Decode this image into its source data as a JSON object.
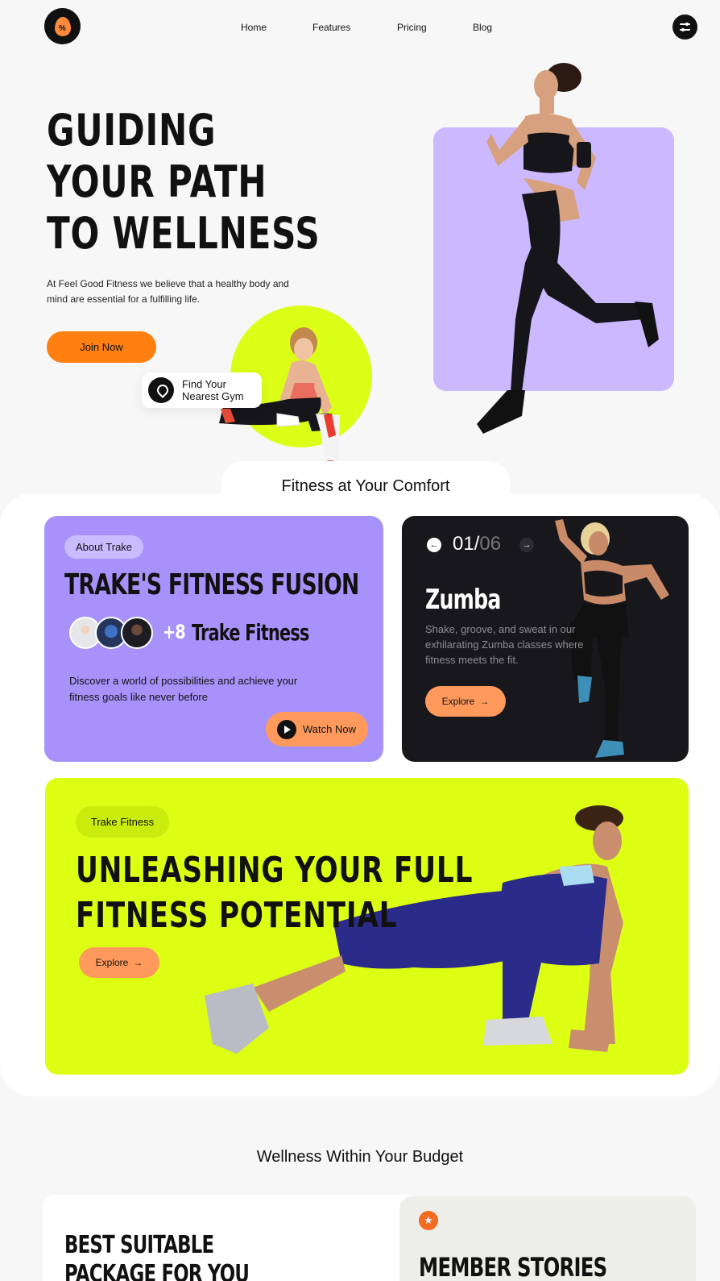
{
  "header": {
    "logo_icon": "flame-percent-icon",
    "nav": [
      "Home",
      "Features",
      "Pricing",
      "Blog"
    ],
    "menu_icon": "sliders-icon"
  },
  "hero": {
    "title_lines": [
      "GUIDING",
      "YOUR PATH",
      "TO WELLNESS"
    ],
    "description": "At Feel Good Fitness we believe that a healthy body and mind are essential for a fulfilling life.",
    "cta": "Join Now",
    "gym_card": {
      "line1": "Find Your",
      "line2": "Nearest Gym",
      "icon": "location-pin-icon"
    },
    "colors": {
      "accent": "#ff7f11",
      "lime": "#dcff17",
      "lavender": "#cbb8ff"
    }
  },
  "comfort": {
    "title": "Fitness at Your Comfort",
    "about_card": {
      "pill": "About Trake",
      "title": "TRAKE'S FITNESS FUSION",
      "plus_count": "+8",
      "group_label": "Trake Fitness",
      "description": "Discover a world of possibilities and achieve your fitness goals like never before",
      "cta": "Watch Now",
      "color": "#a792fb"
    },
    "class_card": {
      "current": "01",
      "separator": "/",
      "total": "06",
      "title": "Zumba",
      "description": "Shake, groove, and sweat in our exhilarating Zumba classes where fitness meets the fit.",
      "cta": "Explore",
      "color": "#17171c"
    },
    "banner": {
      "pill": "Trake Fitness",
      "title_lines": [
        "UNLEASHING YOUR FULL",
        "FITNESS POTENTIAL"
      ],
      "cta": "Explore",
      "color": "#dcff14"
    }
  },
  "budget": {
    "title": "Wellness Within Your Budget",
    "package_title_lines": [
      "BEST SUITABLE",
      "PACKAGE FOR YOU"
    ],
    "stories_title": "MEMBER STORIES",
    "stories_icon": "star-icon"
  }
}
